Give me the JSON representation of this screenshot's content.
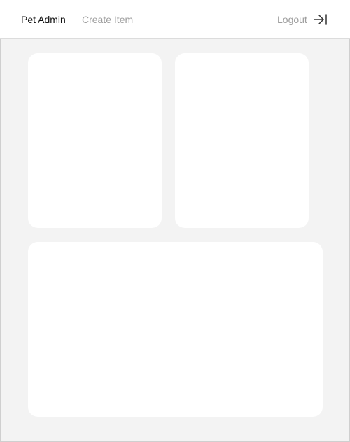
{
  "header": {
    "brand": "Pet Admin",
    "nav": {
      "create_item": "Create Item"
    },
    "logout": {
      "label": "Logout",
      "icon": "logout-arrow-icon"
    }
  },
  "colors": {
    "background": "#f3f3f3",
    "card": "#ffffff",
    "brand_text": "#111111",
    "muted_text": "#9e9e9e"
  }
}
